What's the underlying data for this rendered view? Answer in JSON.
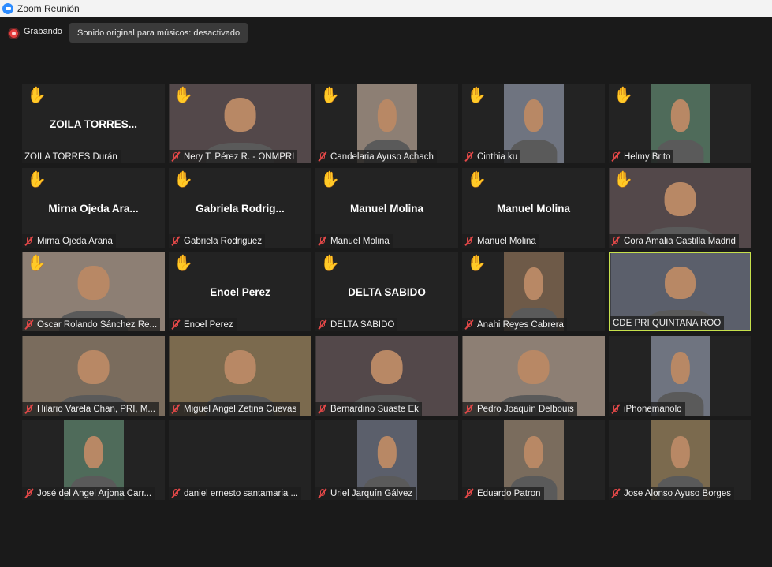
{
  "window": {
    "title": "Zoom Reunión",
    "icon": "zoom-app-icon"
  },
  "toolbar": {
    "recording_label": "Grabando",
    "sound_button_label": "Sonido original para músicos: desactivado"
  },
  "colors": {
    "speaking_border": "#c6e04b",
    "raised_hand": "#f5b82e",
    "muted_mic": "#e34848"
  },
  "participants": [
    {
      "name": "ZOILA TORRES  Durán",
      "display": "ZOILA  TORRES...",
      "hand_raised": true,
      "muted": false,
      "video": false
    },
    {
      "name": "Nery T. Pérez R. - ONMPRI",
      "hand_raised": true,
      "muted": true,
      "video": true
    },
    {
      "name": "Candelaria Ayuso Achach",
      "hand_raised": true,
      "muted": true,
      "video": true
    },
    {
      "name": "Cinthia ku",
      "hand_raised": true,
      "muted": true,
      "video": true
    },
    {
      "name": "Helmy Brito",
      "hand_raised": true,
      "muted": true,
      "video": true
    },
    {
      "name": "Mirna Ojeda Arana",
      "display": "Mirna  Ojeda  Ara...",
      "hand_raised": true,
      "muted": true,
      "video": false
    },
    {
      "name": "Gabriela Rodriguez",
      "display": "Gabriela  Rodrig...",
      "hand_raised": true,
      "muted": true,
      "video": false
    },
    {
      "name": "Manuel Molina",
      "display": "Manuel Molina",
      "hand_raised": true,
      "muted": true,
      "video": false
    },
    {
      "name": "Manuel Molina",
      "display": "Manuel Molina",
      "hand_raised": true,
      "muted": true,
      "video": false
    },
    {
      "name": "Cora Amalia Castilla Madrid",
      "hand_raised": true,
      "muted": true,
      "video": true
    },
    {
      "name": "Oscar Rolando Sánchez Re...",
      "hand_raised": true,
      "muted": true,
      "video": true
    },
    {
      "name": "Enoel Perez",
      "display": "Enoel Perez",
      "hand_raised": true,
      "muted": true,
      "video": false
    },
    {
      "name": "DELTA SABIDO",
      "display": "DELTA SABIDO",
      "hand_raised": true,
      "muted": true,
      "video": false
    },
    {
      "name": "Anahi Reyes Cabrera",
      "hand_raised": true,
      "muted": true,
      "video": true
    },
    {
      "name": "CDE PRI QUINTANA ROO",
      "hand_raised": false,
      "muted": false,
      "video": true,
      "speaking": true
    },
    {
      "name": "Hilario Varela Chan, PRI, M...",
      "hand_raised": false,
      "muted": true,
      "video": true
    },
    {
      "name": "Miguel Angel Zetina Cuevas",
      "hand_raised": false,
      "muted": true,
      "video": true
    },
    {
      "name": "Bernardino Suaste Ek",
      "hand_raised": false,
      "muted": true,
      "video": true
    },
    {
      "name": "Pedro Joaquín Delbouis",
      "hand_raised": false,
      "muted": true,
      "video": true
    },
    {
      "name": "iPhonemanolo",
      "hand_raised": false,
      "muted": true,
      "video": true
    },
    {
      "name": "José del Angel Arjona Carr...",
      "hand_raised": false,
      "muted": true,
      "video": true
    },
    {
      "name": "daniel ernesto santamaria ...",
      "hand_raised": false,
      "muted": true,
      "video": false
    },
    {
      "name": "Uriel Jarquín Gálvez",
      "hand_raised": false,
      "muted": true,
      "video": true
    },
    {
      "name": "Eduardo Patron",
      "hand_raised": false,
      "muted": true,
      "video": true
    },
    {
      "name": "Jose Alonso Ayuso Borges",
      "hand_raised": false,
      "muted": true,
      "video": true
    }
  ]
}
